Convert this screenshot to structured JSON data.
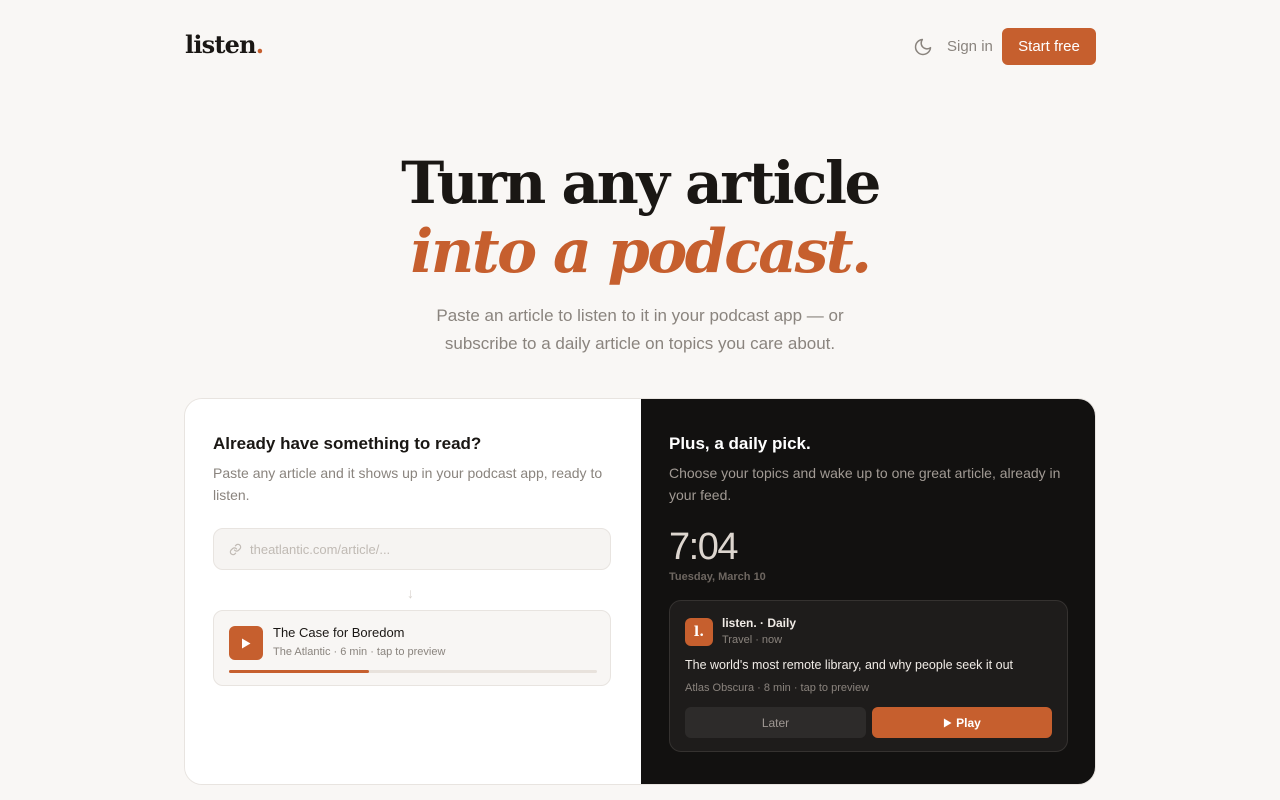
{
  "nav": {
    "brand": "listen",
    "brand_dot": ".",
    "signin": "Sign in",
    "cta": "Start free"
  },
  "hero": {
    "line1": "Turn any article",
    "line2": "into a podcast.",
    "subtitle_1": "Paste an article to listen to it in your podcast app — or",
    "subtitle_2": "subscribe to a daily article on topics you care about."
  },
  "left_panel": {
    "heading": "Already have something to read?",
    "desc": "Paste any article and it shows up in your podcast app, ready to listen.",
    "url_placeholder": "theatlantic.com/article/...",
    "arrow": "↓",
    "episode": {
      "title": "The Case for Boredom",
      "meta": "The Atlantic · 6 min · tap to preview",
      "progress": 0.38
    }
  },
  "right_panel": {
    "heading": "Plus, a daily pick.",
    "desc": "Choose your topics and wake up to one great article, already in your feed.",
    "time": "7:04",
    "date": "Tuesday, March 10",
    "notification": {
      "icon_text": "l.",
      "app": "listen. · Daily",
      "topic": "Travel · now",
      "title": "The world's most remote library, and why people seek it out",
      "meta": "Atlas Obscura · 8 min · tap to preview",
      "later": "Later",
      "play": "Play"
    }
  },
  "colors": {
    "accent": "#c65f2e",
    "background": "#f9f7f5",
    "dark_panel": "#121110"
  }
}
